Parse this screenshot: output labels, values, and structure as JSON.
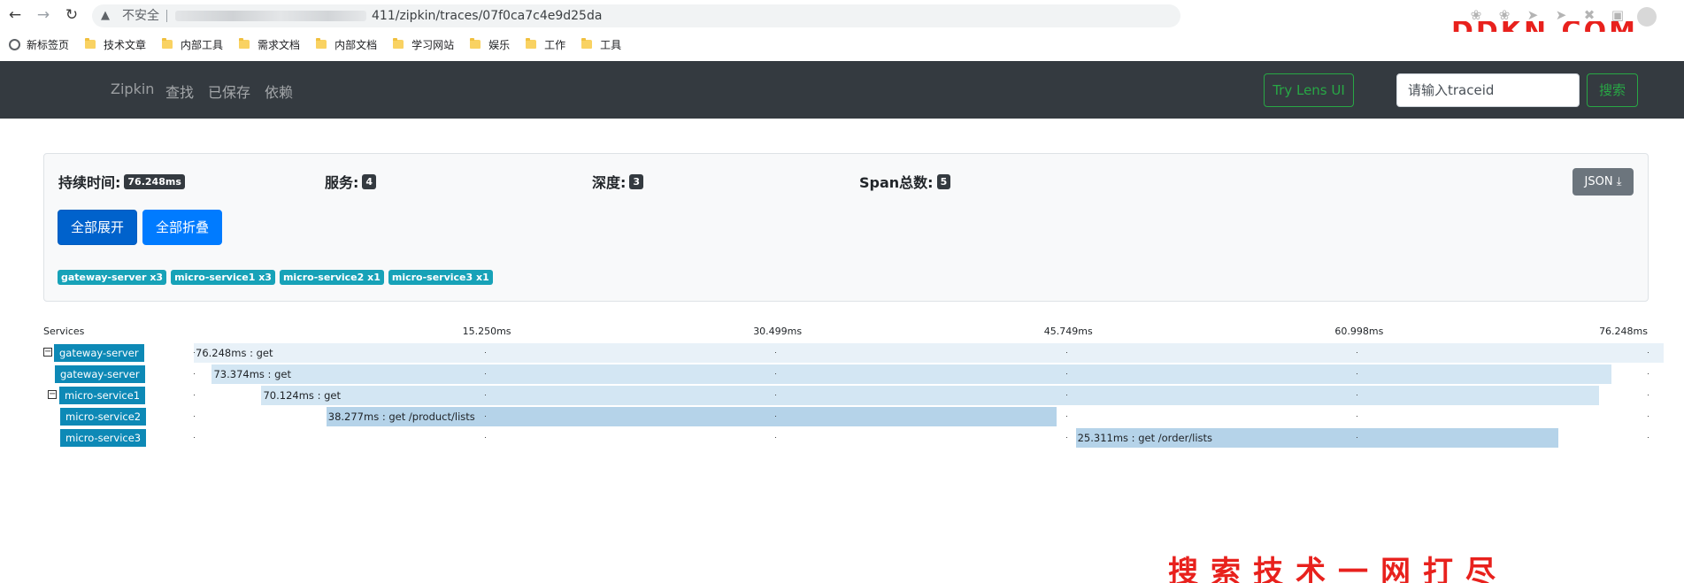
{
  "browser": {
    "security_label": "不安全",
    "url_suffix": "411/zipkin/traces/07f0ca7c4e9d25da",
    "bookmarks": [
      "新标签页",
      "技术文章",
      "内部工具",
      "需求文档",
      "内部文档",
      "学习网站",
      "娱乐",
      "工作",
      "工具"
    ]
  },
  "navbar": {
    "brand": "Zipkin",
    "links": [
      "查找",
      "已保存",
      "依赖"
    ],
    "lens_button": "Try Lens UI",
    "search_placeholder": "请输入traceid",
    "search_button": "搜索"
  },
  "summary": {
    "duration_label": "持续时间:",
    "duration_value": "76.248ms",
    "services_label": "服务:",
    "services_value": "4",
    "depth_label": "深度:",
    "depth_value": "3",
    "spans_label": "Span总数:",
    "spans_value": "5",
    "json_button": "JSON",
    "expand_all": "全部展开",
    "collapse_all": "全部折叠",
    "service_badges": [
      "gateway-server x3",
      "micro-service1 x3",
      "micro-service2 x1",
      "micro-service3 x1"
    ]
  },
  "timeline": {
    "services_header": "Services",
    "ticks": [
      "15.250ms",
      "30.499ms",
      "45.749ms",
      "60.998ms",
      "76.248ms"
    ],
    "total_ms": 76.248,
    "spans": [
      {
        "service": "gateway-server",
        "label": "76.248ms : get",
        "start_ms": 0,
        "duration_ms": 76.248,
        "toggle": "−",
        "depth": 0
      },
      {
        "service": "gateway-server",
        "label": "73.374ms : get",
        "start_ms": 0.95,
        "duration_ms": 73.374,
        "toggle": "",
        "depth": 0
      },
      {
        "service": "micro-service1",
        "label": "70.124ms : get",
        "start_ms": 3.55,
        "duration_ms": 70.124,
        "toggle": "−",
        "depth": 1
      },
      {
        "service": "micro-service2",
        "label": "38.277ms : get /product/lists",
        "start_ms": 6.95,
        "duration_ms": 38.277,
        "toggle": "",
        "depth": 2
      },
      {
        "service": "micro-service3",
        "label": "25.311ms : get /order/lists",
        "start_ms": 46.25,
        "duration_ms": 25.311,
        "toggle": "",
        "depth": 2
      }
    ]
  },
  "colors": {
    "navbar_bg": "#343a40",
    "accent_green": "#28a745",
    "primary_blue": "#007bff",
    "service_label_bg": "#0d89b6",
    "span_bar": "#b5d3e9",
    "span_track": "#e8f1f8"
  }
}
